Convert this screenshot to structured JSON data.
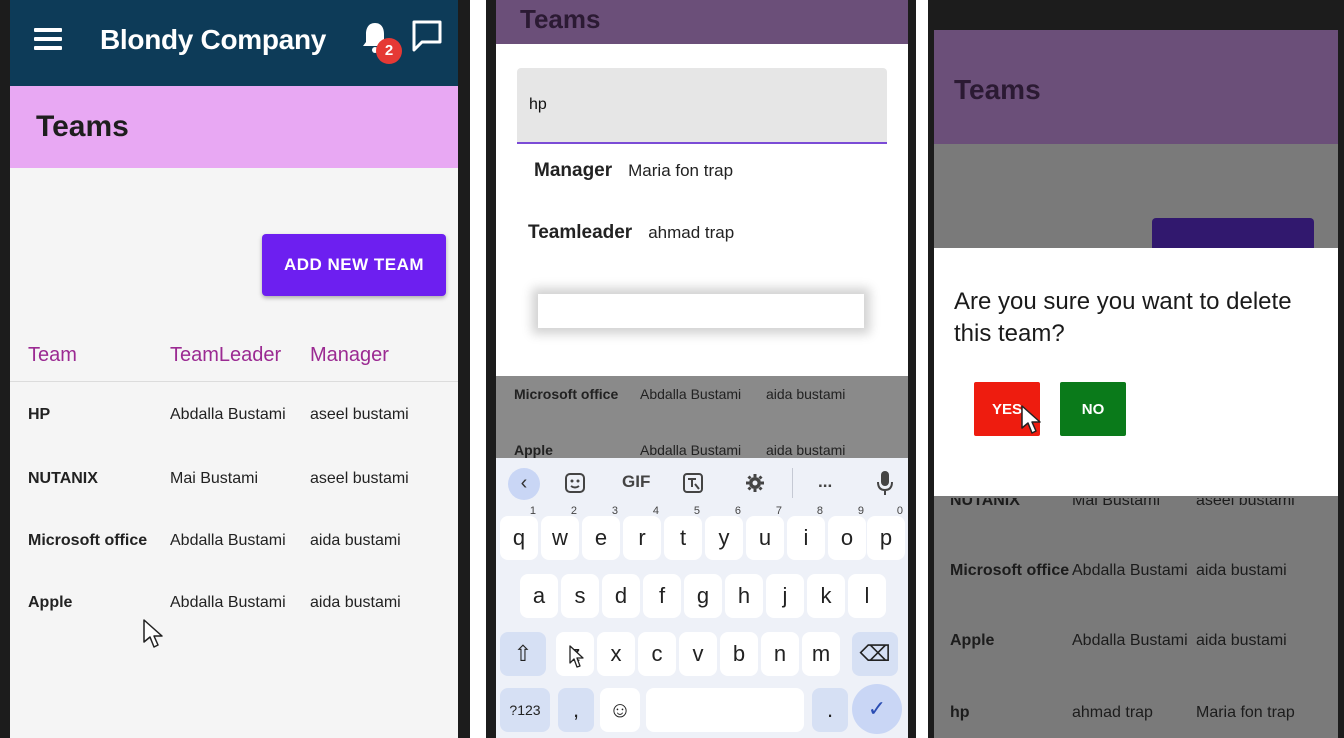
{
  "panel1": {
    "app_title": "Blondy Company",
    "notification_count": "2",
    "page_title": "Teams",
    "add_button": "ADD NEW TEAM",
    "columns": [
      "Team",
      "TeamLeader",
      "Manager"
    ],
    "rows": [
      {
        "team": "HP",
        "leader": "Abdalla Bustami",
        "manager": "aseel bustami"
      },
      {
        "team": "NUTANIX",
        "leader": "Mai Bustami",
        "manager": "aseel bustami"
      },
      {
        "team": "Microsoft office",
        "leader": "Abdalla Bustami",
        "manager": "aida bustami"
      },
      {
        "team": "Apple",
        "leader": "Abdalla Bustami",
        "manager": "aida bustami"
      }
    ]
  },
  "panel2": {
    "page_title": "Teams",
    "search_value": "hp",
    "manager_label": "Manager",
    "manager_value": "Maria fon  trap",
    "teamleader_label": "Teamleader",
    "teamleader_value": "ahmad trap",
    "bg_rows": [
      {
        "team": "Microsoft office",
        "leader": "Abdalla Bustami",
        "manager": "aida bustami"
      },
      {
        "team": "Apple",
        "leader": "Abdalla Bustami",
        "manager": "aida bustami"
      }
    ],
    "keyboard": {
      "toolbar": [
        "GIF",
        "..."
      ],
      "row1": [
        "q",
        "w",
        "e",
        "r",
        "t",
        "y",
        "u",
        "i",
        "o",
        "p"
      ],
      "row1_nums": [
        "1",
        "2",
        "3",
        "4",
        "5",
        "6",
        "7",
        "8",
        "9",
        "0"
      ],
      "row2": [
        "a",
        "s",
        "d",
        "f",
        "g",
        "h",
        "j",
        "k",
        "l"
      ],
      "row3": [
        "z",
        "x",
        "c",
        "v",
        "b",
        "n",
        "m"
      ],
      "sym_key": "?123",
      "comma": ",",
      "period": "."
    }
  },
  "panel3": {
    "page_title": "Teams",
    "dialog_text": "Are you sure you want to delete this team?",
    "yes_label": "YES",
    "no_label": "NO",
    "partial_row": {
      "team": "NUTANIX",
      "leader": "Mai Bustami",
      "manager": "aseel bustami"
    },
    "rows": [
      {
        "team": "Microsoft office",
        "leader": "Abdalla Bustami",
        "manager": "aida bustami"
      },
      {
        "team": "Apple",
        "leader": "Abdalla Bustami",
        "manager": "aida bustami"
      },
      {
        "team": "hp",
        "leader": "ahmad trap",
        "manager": "Maria fon  trap"
      }
    ]
  }
}
